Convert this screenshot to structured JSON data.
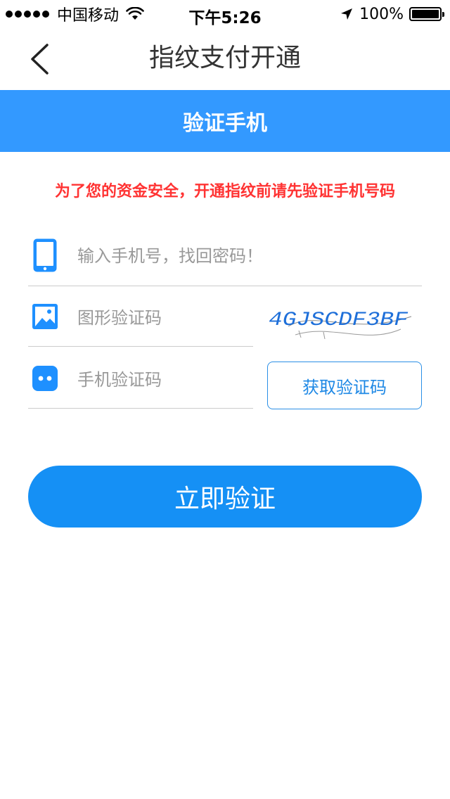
{
  "status_bar": {
    "carrier": "中国移动",
    "time": "下午5:26",
    "battery": "100%"
  },
  "nav": {
    "title": "指纹支付开通",
    "back_icon": "chevron-left-icon"
  },
  "banner": {
    "title": "验证手机"
  },
  "notice": "为了您的资金安全，开通指纹前请先验证手机号码",
  "form": {
    "phone_placeholder": "输入手机号，找回密码！",
    "captcha_placeholder": "图形验证码",
    "captcha_text": "4GJSCDF3BF",
    "sms_placeholder": "手机验证码",
    "sms_button": "获取验证码"
  },
  "submit_label": "立即验证",
  "colors": {
    "primary": "#3399ff",
    "button": "#1590f5",
    "warning": "#ff3333",
    "icon": "#1e90ff"
  }
}
